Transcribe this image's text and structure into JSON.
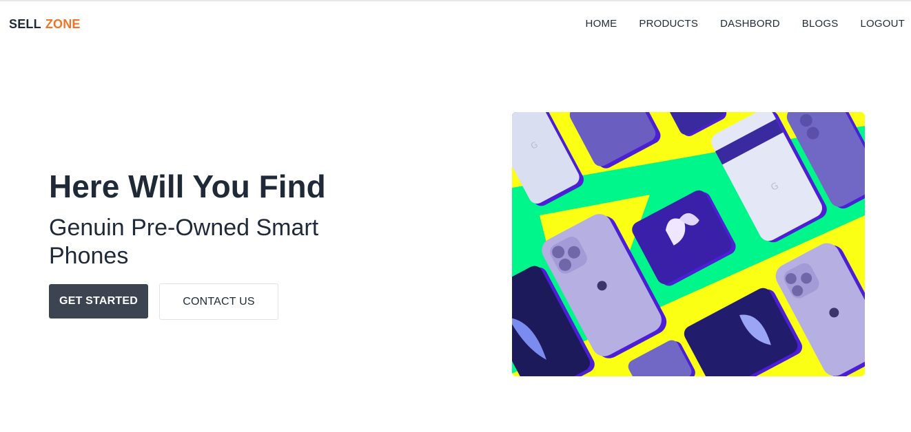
{
  "brand": {
    "part1": "SELL",
    "part2": "ZONE"
  },
  "nav": {
    "items": [
      {
        "label": "HOME"
      },
      {
        "label": "PRODUCTS"
      },
      {
        "label": "DASHBORD"
      },
      {
        "label": "BLOGS"
      },
      {
        "label": "LOGOUT"
      }
    ]
  },
  "hero": {
    "title": "Here Will You Find",
    "subtitle": "Genuin Pre-Owned Smart Phones",
    "primary_button": "GET STARTED",
    "secondary_button": "CONTACT US"
  },
  "colors": {
    "accent": "#f07427",
    "text": "#1f2937",
    "primary_button_bg": "#3d4451",
    "image_yellow": "#fbff14",
    "image_green": "#00f58a",
    "phone_purple": "#6a5fc1",
    "phone_deep": "#4a1fd6"
  }
}
